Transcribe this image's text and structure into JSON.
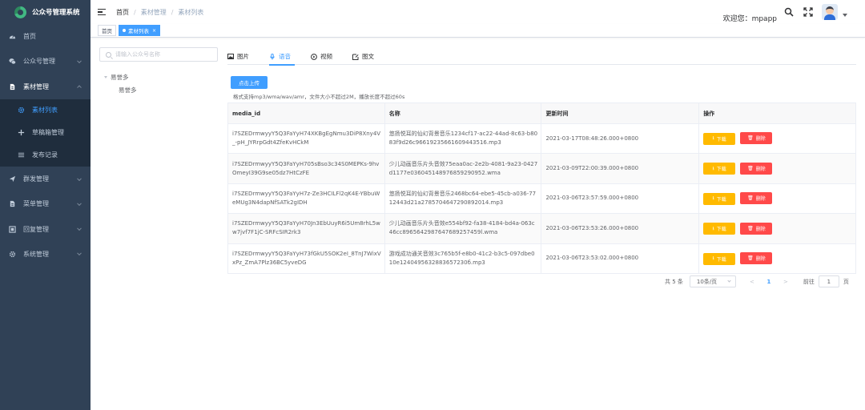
{
  "app": {
    "title": "公众号管理系统"
  },
  "sidebar": {
    "items": [
      {
        "label": "首页",
        "icon": "dashboard-icon"
      },
      {
        "label": "公众号管理",
        "icon": "wechat-icon"
      },
      {
        "label": "素材管理",
        "icon": "document-icon"
      },
      {
        "label": "群发管理",
        "icon": "send-icon"
      },
      {
        "label": "菜单管理",
        "icon": "menu-doc-icon"
      },
      {
        "label": "回复管理",
        "icon": "reply-icon"
      },
      {
        "label": "系统管理",
        "icon": "gear-icon"
      }
    ],
    "submenu": [
      {
        "label": "素材列表",
        "icon": "gear-icon"
      },
      {
        "label": "草稿箱管理",
        "icon": "plus-icon"
      },
      {
        "label": "发布记录",
        "icon": "list-icon"
      }
    ]
  },
  "navbar": {
    "breadcrumb": [
      "首页",
      "素材管理",
      "素材列表"
    ],
    "breadcrumb_sep": "/",
    "welcome": "欢迎您：mpapp"
  },
  "tags": [
    {
      "label": "首页"
    },
    {
      "label": "素材列表",
      "close": "×"
    }
  ],
  "account": {
    "search_placeholder": "请输入公众号名称",
    "tree_root": "易誉多",
    "tree_child": "易誉多"
  },
  "tabs": [
    {
      "label": "图片",
      "icon": "image-icon"
    },
    {
      "label": "语音",
      "icon": "microphone-icon"
    },
    {
      "label": "视频",
      "icon": "play-icon"
    },
    {
      "label": "图文",
      "icon": "article-icon"
    }
  ],
  "upload": {
    "button": "点击上传",
    "tip": "格式支持mp3/wma/wav/amr，文件大小不超过2M，播放长度不超过60s"
  },
  "table": {
    "headers": [
      "media_id",
      "名称",
      "更新时间",
      "操作"
    ],
    "rows": [
      {
        "media_id": "i7SZEDrmwyyY5Q3FaYyH74XKBgEgNmu3DiP8Xny4V_-pH_JYRrpGdt4ZfeKvHCkM",
        "name": "悠扬悦耳的仙幻背景音乐1234cf17-ac22-44ad-8c63-b8083f9d26c96619235661609443516.mp3",
        "time": "2021-03-17T08:48:26.000+0800"
      },
      {
        "media_id": "i7SZEDrmwyyY5Q3FaYyH705sBso3c34S0MEPKs-9hvOmeyI39G9se05dz7HtCzFE",
        "name": "少儿动画音乐片头音效75eaa0ac-2e2b-4081-9a23-0427d1177e036045148976859290952.wma",
        "time": "2021-03-09T22:00:39.000+0800"
      },
      {
        "media_id": "i7SZEDrmwyyY5Q3FaYyH7z-Ze3HCILFl2qK4E-YBbuWeMUg3N4dapNfSATk2gIDH",
        "name": "悠扬悦耳的仙幻背景音乐2468bc64-ebe5-45cb-a036-7712443d21a2785704647290892014.mp3",
        "time": "2021-03-06T23:57:59.000+0800"
      },
      {
        "media_id": "i7SZEDrmwyyY5Q3FaYyH70Jn3EbUuyR6i5Um8rhL5ww7jvf7F1jC-SRFcSIR2rk3",
        "name": "少儿动画音乐片头音效e554bf92-fa38-4184-bd4a-063c46cc8965642987647689257459l.wma",
        "time": "2021-03-06T23:53:26.000+0800"
      },
      {
        "media_id": "i7SZEDrmwyyY5Q3FaYyH73fGkU5SOK2eI_8TnJ7WixVxPz_ZmA7Plz36BC5yveDG",
        "name": "游戏成功通关音效3c765b5f-e8b0-41c2-b3c5-097dbe010e1240495632883657230б.mp3",
        "time": "2021-03-06T23:53:02.000+0800"
      }
    ],
    "download": "下载",
    "delete": "删除"
  },
  "pagination": {
    "total": "共 5 条",
    "page_size": "10条/页",
    "prev": "<",
    "current": "1",
    "next": ">",
    "goto_label": "前往",
    "goto_value": "1",
    "page_suffix": "页"
  },
  "colors": {
    "sidebar": "#304156",
    "primary": "#409eff",
    "warning": "#ffba00",
    "danger": "#ff4949"
  }
}
